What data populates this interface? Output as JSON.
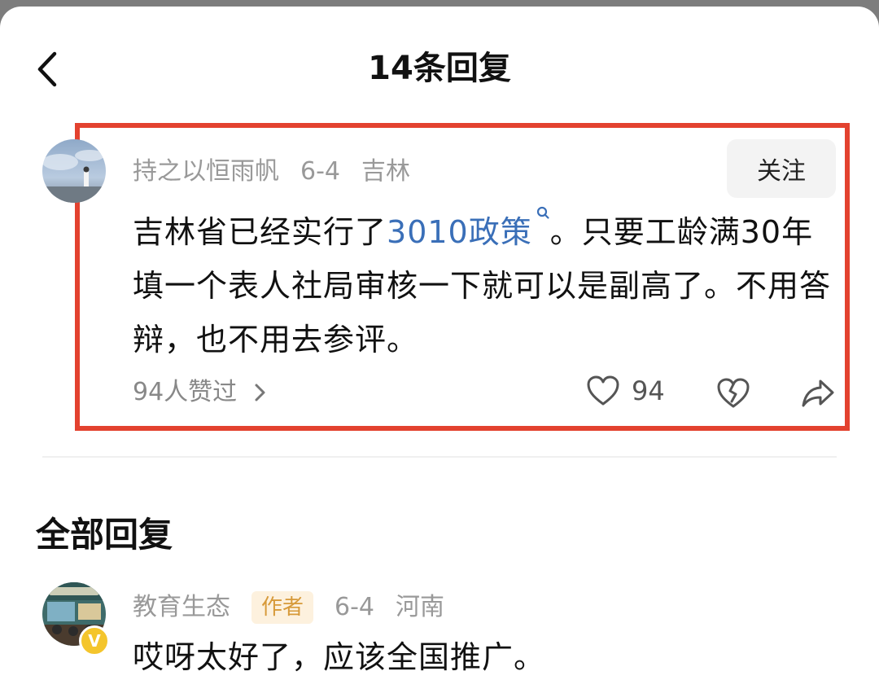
{
  "header": {
    "title": "14条回复",
    "back_icon": "chevron-left-icon"
  },
  "comment": {
    "author": "持之以恒雨帆",
    "date": "6-4",
    "location": "吉林",
    "follow_label": "关注",
    "text_before": "吉林省已经实行了",
    "link_text": "3010政策",
    "text_after": "。只要工龄满30年填一个表人社局审核一下就可以是副高了。不用答辩，也不用去参评。",
    "likes_summary": "94人赞过",
    "like_count": "94",
    "highlight_color": "#e3422f"
  },
  "section": {
    "title": "全部回复"
  },
  "replies": [
    {
      "author": "教育生态",
      "tag": "作者",
      "date": "6-4",
      "location": "河南",
      "text": "哎呀太好了，应该全国推广。",
      "badge": "V"
    }
  ]
}
